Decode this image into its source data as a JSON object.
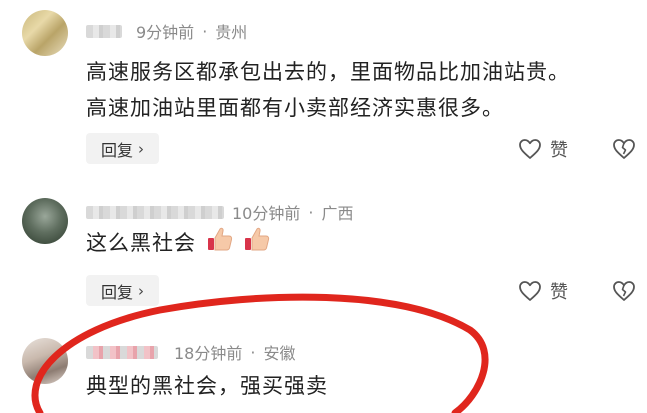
{
  "comments": [
    {
      "time": "9分钟前",
      "location": "贵州",
      "lines": [
        "高速服务区都承包出去的，里面物品比加油站贵。",
        "高速加油站里面都有小卖部经济实惠很多。"
      ],
      "reply_label": "回复",
      "like_label": "赞"
    },
    {
      "time": "10分钟前",
      "location": "广西",
      "lines": [
        "这么黑社会"
      ],
      "reply_label": "回复",
      "like_label": "赞"
    },
    {
      "time": "18分钟前",
      "location": "安徽",
      "lines": [
        "典型的黑社会，强买强卖"
      ]
    }
  ],
  "separator": "·",
  "reply_chevron": "›",
  "icons": {
    "like": "heart-outline-icon",
    "dislike": "broken-heart-icon",
    "emoji": "thumbs-up-emoji"
  },
  "colors": {
    "meta_text": "#8a8a8a",
    "annotation_circle": "#e0261d"
  }
}
